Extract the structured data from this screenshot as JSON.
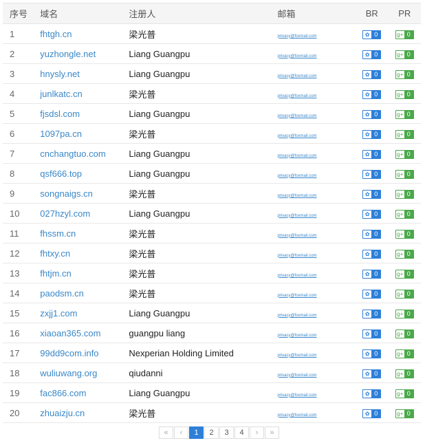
{
  "headers": {
    "no": "序号",
    "domain": "域名",
    "registrant": "注册人",
    "email": "邮箱",
    "br": "BR",
    "pr": "PR"
  },
  "rows": [
    {
      "no": "1",
      "domain": "fhtgh.cn",
      "registrant": "梁光普",
      "email": "privacy@foxmail.com",
      "br": "0",
      "pr": "0"
    },
    {
      "no": "2",
      "domain": "yuzhongle.net",
      "registrant": "Liang Guangpu",
      "email": "privacy@foxmail.com",
      "br": "0",
      "pr": "0"
    },
    {
      "no": "3",
      "domain": "hnysly.net",
      "registrant": "Liang Guangpu",
      "email": "privacy@foxmail.com",
      "br": "0",
      "pr": "0"
    },
    {
      "no": "4",
      "domain": "junlkatc.cn",
      "registrant": "梁光普",
      "email": "privacy@foxmail.com",
      "br": "0",
      "pr": "0"
    },
    {
      "no": "5",
      "domain": "fjsdsl.com",
      "registrant": "Liang Guangpu",
      "email": "privacy@foxmail.com",
      "br": "0",
      "pr": "0"
    },
    {
      "no": "6",
      "domain": "1097pa.cn",
      "registrant": "梁光普",
      "email": "privacy@foxmail.com",
      "br": "0",
      "pr": "0"
    },
    {
      "no": "7",
      "domain": "cnchangtuo.com",
      "registrant": "Liang Guangpu",
      "email": "privacy@foxmail.com",
      "br": "0",
      "pr": "0"
    },
    {
      "no": "8",
      "domain": "qsf666.top",
      "registrant": "Liang Guangpu",
      "email": "privacy@foxmail.com",
      "br": "0",
      "pr": "0"
    },
    {
      "no": "9",
      "domain": "songnaigs.cn",
      "registrant": "梁光普",
      "email": "privacy@foxmail.com",
      "br": "0",
      "pr": "0"
    },
    {
      "no": "10",
      "domain": "027hzyl.com",
      "registrant": "Liang Guangpu",
      "email": "privacy@foxmail.com",
      "br": "0",
      "pr": "0"
    },
    {
      "no": "11",
      "domain": "fhssm.cn",
      "registrant": "梁光普",
      "email": "privacy@foxmail.com",
      "br": "0",
      "pr": "0"
    },
    {
      "no": "12",
      "domain": "fhtxy.cn",
      "registrant": "梁光普",
      "email": "privacy@foxmail.com",
      "br": "0",
      "pr": "0"
    },
    {
      "no": "13",
      "domain": "fhtjm.cn",
      "registrant": "梁光普",
      "email": "privacy@foxmail.com",
      "br": "0",
      "pr": "0"
    },
    {
      "no": "14",
      "domain": "paodsm.cn",
      "registrant": "梁光普",
      "email": "privacy@foxmail.com",
      "br": "0",
      "pr": "0"
    },
    {
      "no": "15",
      "domain": "zxjj1.com",
      "registrant": "Liang Guangpu",
      "email": "privacy@foxmail.com",
      "br": "0",
      "pr": "0"
    },
    {
      "no": "16",
      "domain": "xiaoan365.com",
      "registrant": "guangpu liang",
      "email": "privacy@foxmail.com",
      "br": "0",
      "pr": "0"
    },
    {
      "no": "17",
      "domain": "99dd9com.info",
      "registrant": "Nexperian Holding Limited",
      "email": "privacy@foxmail.com",
      "br": "0",
      "pr": "0"
    },
    {
      "no": "18",
      "domain": "wuliuwang.org",
      "registrant": "qiudanni",
      "email": "privacy@foxmail.com",
      "br": "0",
      "pr": "0"
    },
    {
      "no": "19",
      "domain": "fac866.com",
      "registrant": "Liang Guangpu",
      "email": "privacy@foxmail.com",
      "br": "0",
      "pr": "0"
    },
    {
      "no": "20",
      "domain": "zhuaizju.cn",
      "registrant": "梁光普",
      "email": "privacy@foxmail.com",
      "br": "0",
      "pr": "0"
    }
  ],
  "icons": {
    "br": "paw-icon",
    "pr": "google-plus-icon"
  },
  "colors": {
    "link": "#3a87c8",
    "br": "#2d7fd8",
    "pr": "#4aa84a"
  },
  "pagination": {
    "first": "«",
    "prev": "‹",
    "pages": [
      "1",
      "2",
      "3",
      "4"
    ],
    "current": "1",
    "next": "›",
    "last": "»"
  }
}
